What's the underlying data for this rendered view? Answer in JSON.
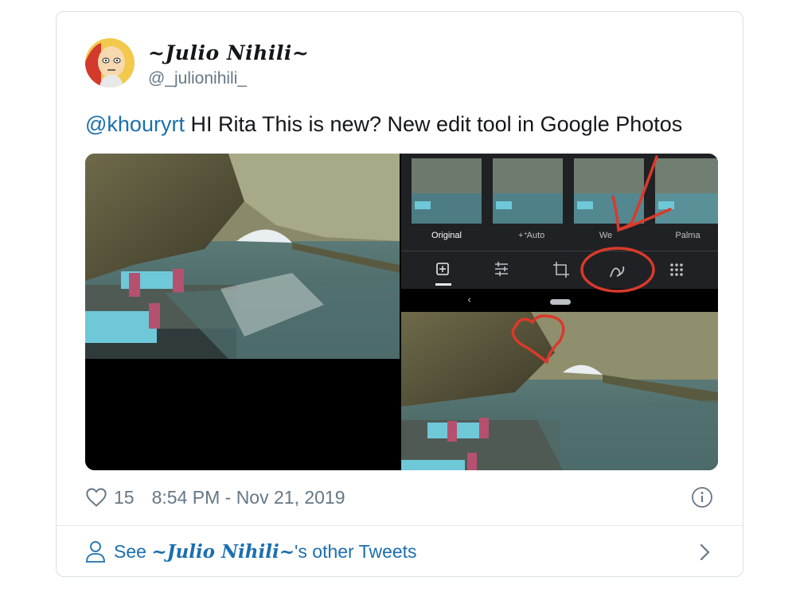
{
  "tweet": {
    "display_name": "~Julio Nihili~",
    "handle": "@_julionihili_",
    "mention": "@khouryrt",
    "text": " HI Rita This is new? New edit tool in Google Photos",
    "like_count": "15",
    "timestamp": "8:54 PM - Nov 21, 2019"
  },
  "media": {
    "filter_labels": [
      "Original",
      "Auto",
      "We",
      "Palma"
    ],
    "auto_icon": "sparkle-icon",
    "toolbar_icons": [
      "suggestions-icon",
      "adjust-icon",
      "crop-rotate-icon",
      "markup-icon",
      "more-grid-icon"
    ],
    "annotation_color": "#d93a2b"
  },
  "footer": {
    "see_prefix": "See ",
    "see_name": "~Julio Nihili~",
    "see_suffix": "'s other Tweets"
  },
  "colors": {
    "link": "#1b6fae",
    "muted": "#657786",
    "border": "#d8dfe4"
  }
}
